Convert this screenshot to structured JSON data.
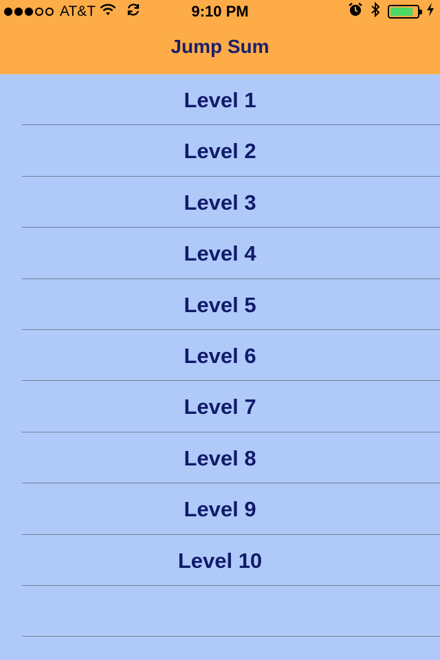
{
  "status_bar": {
    "signal_dots": [
      true,
      true,
      true,
      false,
      false
    ],
    "carrier": "AT&T",
    "time": "9:10 PM",
    "battery_level": 0.85,
    "battery_color": "#4cd964",
    "icons": [
      "wifi-icon",
      "sync-icon",
      "alarm-icon",
      "bluetooth-icon",
      "battery-icon",
      "charging-bolt-icon"
    ]
  },
  "nav": {
    "title": "Jump Sum",
    "background": "#fdac47",
    "title_color": "#1a1f6b"
  },
  "list": {
    "background": "#afcaf9",
    "text_color": "#101a6a",
    "items": [
      {
        "label": "Level 1"
      },
      {
        "label": "Level 2"
      },
      {
        "label": "Level 3"
      },
      {
        "label": "Level 4"
      },
      {
        "label": "Level 5"
      },
      {
        "label": "Level 6"
      },
      {
        "label": "Level 7"
      },
      {
        "label": "Level 8"
      },
      {
        "label": "Level 9"
      },
      {
        "label": "Level 10"
      },
      {
        "label": ""
      }
    ]
  }
}
